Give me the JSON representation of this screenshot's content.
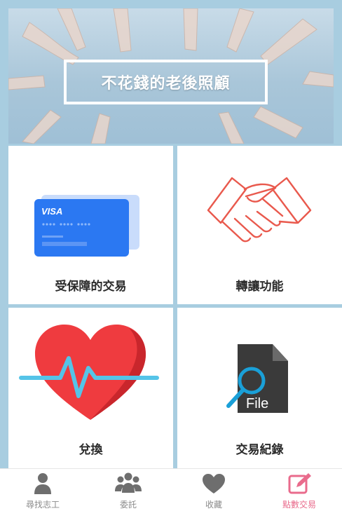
{
  "hero": {
    "title": "不花錢的老後照顧"
  },
  "tiles": [
    {
      "label": "受保障的交易",
      "icon": "credit-card-icon"
    },
    {
      "label": "轉讓功能",
      "icon": "handshake-icon"
    },
    {
      "label": "兌換",
      "icon": "heart-pulse-icon"
    },
    {
      "label": "交易紀錄",
      "icon": "file-search-icon",
      "file_text": "File"
    }
  ],
  "card": {
    "brand": "VISA"
  },
  "tabbar": {
    "items": [
      {
        "label": "尋找志工",
        "icon": "person-icon",
        "active": false
      },
      {
        "label": "委託",
        "icon": "group-icon",
        "active": false
      },
      {
        "label": "收藏",
        "icon": "heart-icon",
        "active": false
      },
      {
        "label": "點數交易",
        "icon": "edit-icon",
        "active": true
      }
    ],
    "inactive_color": "#8a8a8a",
    "active_color": "#e96b8c"
  },
  "colors": {
    "grid_line": "#a8cde0",
    "handshake": "#e9594d",
    "heart": "#ef3b3f",
    "pulse": "#55c4e8",
    "card": "#1f6ff2"
  }
}
